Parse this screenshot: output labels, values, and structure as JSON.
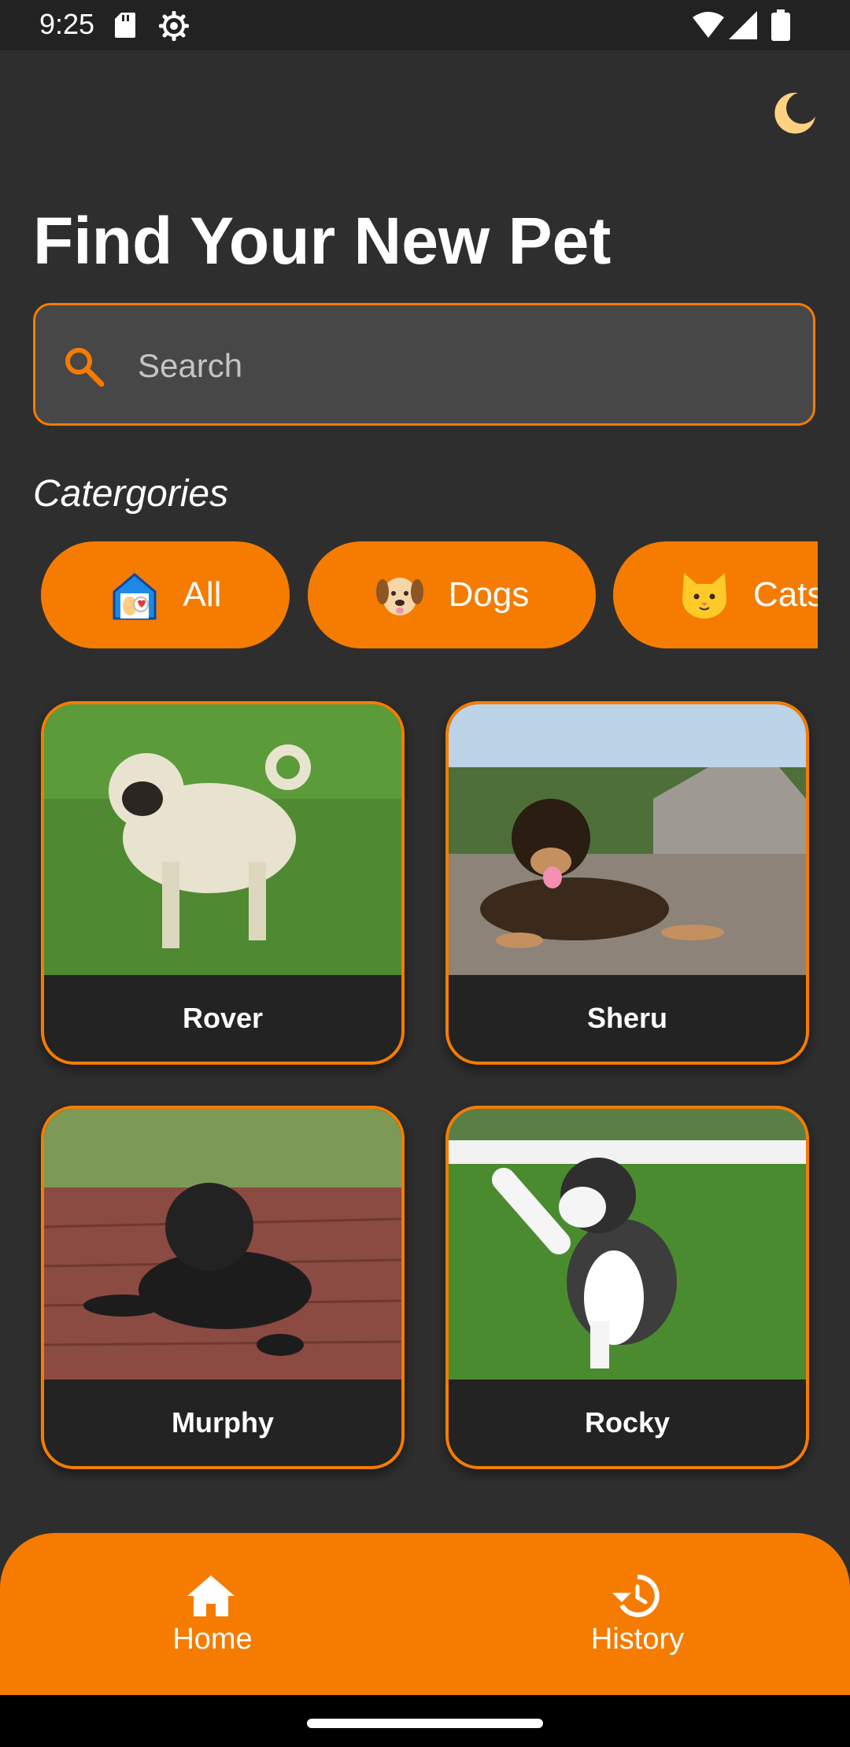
{
  "status_bar": {
    "time": "9:25"
  },
  "header": {
    "title": "Find Your New Pet"
  },
  "search": {
    "placeholder": "Search"
  },
  "categories": {
    "title": "Catergories",
    "items": [
      {
        "label": "All",
        "icon": "pet-house-icon"
      },
      {
        "label": "Dogs",
        "icon": "dog-face-icon"
      },
      {
        "label": "Cats",
        "icon": "cat-face-icon"
      }
    ]
  },
  "pets": [
    {
      "name": "Rover",
      "photo": "pug-standing-photo"
    },
    {
      "name": "Sheru",
      "photo": "german-shepherd-puppy-photo"
    },
    {
      "name": "Murphy",
      "photo": "black-pug-lying-photo"
    },
    {
      "name": "Rocky",
      "photo": "husky-puppy-photo"
    }
  ],
  "bottom_nav": {
    "items": [
      {
        "label": "Home",
        "icon": "home-icon"
      },
      {
        "label": "History",
        "icon": "history-icon"
      }
    ]
  },
  "colors": {
    "accent": "#f57c00",
    "background": "#2e2e2e",
    "card_background": "#232323",
    "search_background": "#474747",
    "moon": "#ffd180"
  }
}
